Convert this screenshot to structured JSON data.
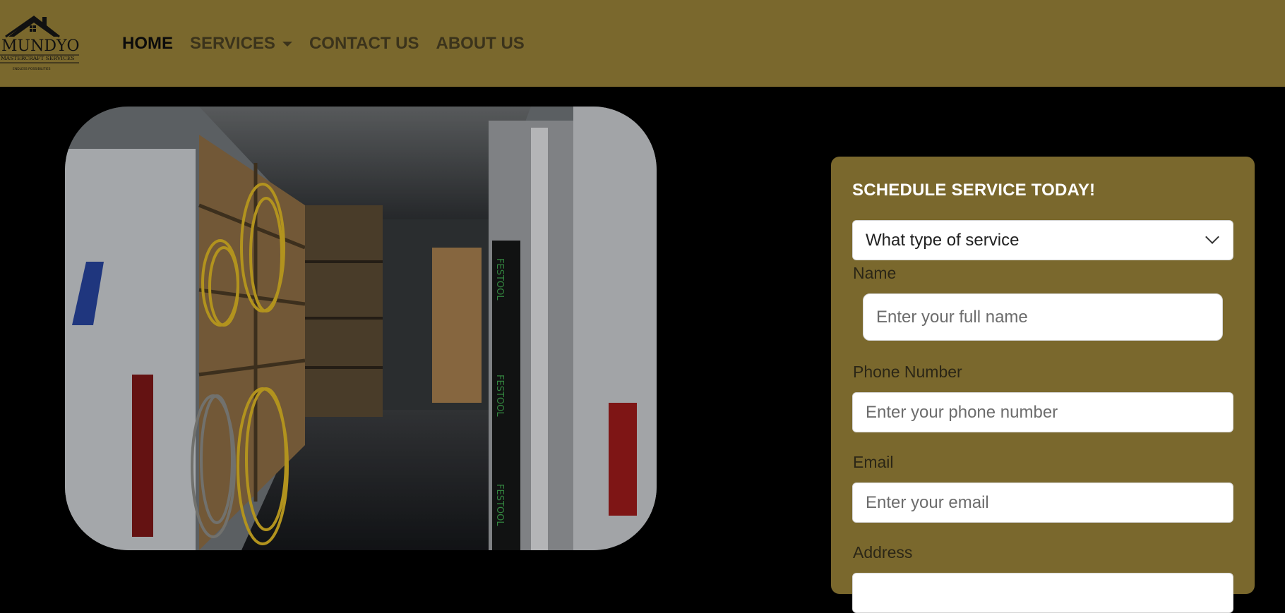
{
  "brand": {
    "logo_name": "MUNDYO",
    "logo_tagline": "MASTERCRAFT SERVICES",
    "logo_subtag": "ENDLESS POSSIBILITIES"
  },
  "nav": {
    "home": "HOME",
    "services": "SERVICES",
    "contact": "CONTACT US",
    "about": "ABOUT US"
  },
  "hero": {
    "photo_desc": "Work van interior with tools and cords",
    "van_text_1": "FESTOOL",
    "van_text_2": "FESTOOL",
    "van_text_3": "FESTOOL"
  },
  "form": {
    "title": "SCHEDULE SERVICE TODAY!",
    "service_select": "What type of service",
    "name_label": "Name",
    "name_placeholder": "Enter your full name",
    "phone_label": "Phone Number",
    "phone_placeholder": "Enter your phone number",
    "email_label": "Email",
    "email_placeholder": "Enter your email",
    "address_label": "Address"
  },
  "colors": {
    "nav_bg": "#7a682d",
    "page_bg": "#000000",
    "form_bg": "#7a682d",
    "nav_text": "#3b331b",
    "title_text": "#ffffff"
  }
}
